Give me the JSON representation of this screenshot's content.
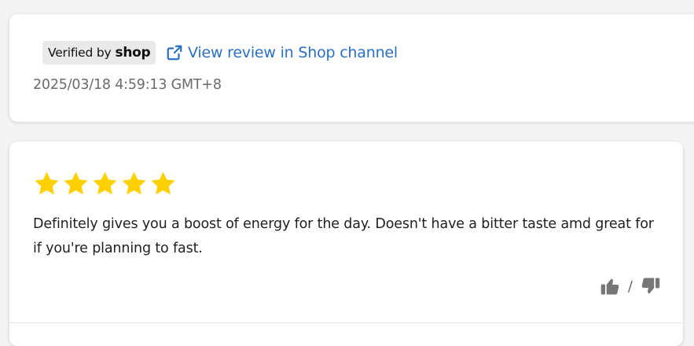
{
  "top_card": {
    "verified_prefix": "Verified by",
    "verified_brand": "shop",
    "view_review_link": "View review in Shop channel",
    "timestamp": "2025/03/18 4:59:13 GMT+8"
  },
  "review": {
    "rating": 5,
    "max_rating": 5,
    "text": "Definitely gives you a boost of energy for the day. Doesn't have a bitter taste amd great for if you're planning to fast.",
    "vote_separator": "/"
  },
  "icons": {
    "external_link": "external-link-icon",
    "star": "star-icon",
    "thumbs_up": "thumbs-up-icon",
    "thumbs_down": "thumbs-down-icon"
  },
  "colors": {
    "link": "#2a6fc0",
    "star": "#ffd000",
    "badge_bg": "#e9e9e9",
    "vote_icon": "#777777"
  }
}
